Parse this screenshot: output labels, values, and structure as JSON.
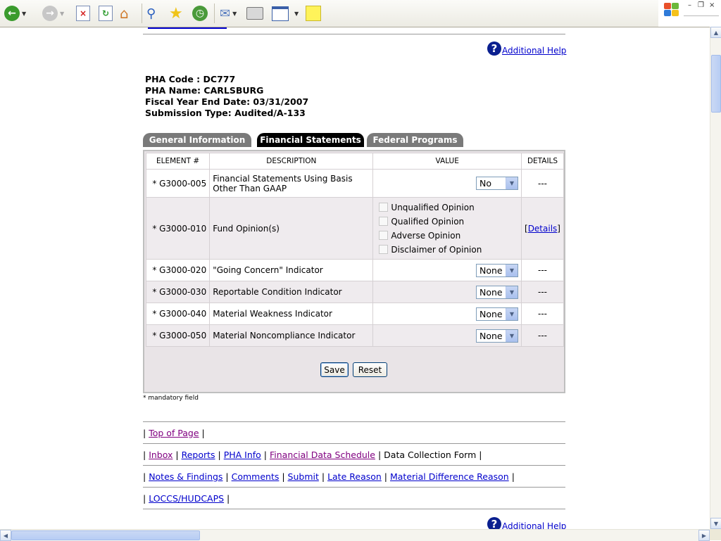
{
  "header": {
    "help_label": "Additional Help"
  },
  "pha": {
    "code": "PHA Code : DC777",
    "name": "PHA Name: CARLSBURG",
    "fiscal": "Fiscal Year End Date: 03/31/2007",
    "submission": "Submission Type: Audited/A-133"
  },
  "tabs": [
    "General Information",
    "Financial Statements",
    "Federal Programs"
  ],
  "columns": [
    "ELEMENT #",
    "DESCRIPTION",
    "VALUE",
    "DETAILS"
  ],
  "rows": [
    {
      "element": "* G3000-005",
      "desc1": "Financial Statements Using Basis",
      "desc2": "Other Than GAAP",
      "value": "No",
      "details": "---"
    },
    {
      "element": "* G3000-010",
      "desc": "Fund Opinion(s)",
      "options": [
        "Unqualified Opinion",
        "Qualified Opinion",
        "Adverse Opinion",
        "Disclaimer of Opinion"
      ],
      "details_link": "Details"
    },
    {
      "element": "* G3000-020",
      "desc": "\"Going Concern\" Indicator",
      "value": "None",
      "details": "---"
    },
    {
      "element": "* G3000-030",
      "desc": "Reportable Condition Indicator",
      "value": "None",
      "details": "---"
    },
    {
      "element": "* G3000-040",
      "desc": "Material Weakness Indicator",
      "value": "None",
      "details": "---"
    },
    {
      "element": "* G3000-050",
      "desc": "Material Noncompliance Indicator",
      "value": "None",
      "details": "---"
    }
  ],
  "buttons": {
    "save": "Save",
    "reset": "Reset"
  },
  "mandatory_note": "* mandatory field",
  "nav": {
    "top": "Top of Page",
    "line2": [
      "Inbox",
      "Reports",
      "PHA Info",
      "Financial Data Schedule"
    ],
    "current": "Data Collection Form",
    "line3": [
      "Notes & Findings",
      "Comments",
      "Submit",
      "Late Reason",
      "Material Difference Reason"
    ],
    "line4": [
      "LOCCS/HUDCAPS"
    ]
  }
}
